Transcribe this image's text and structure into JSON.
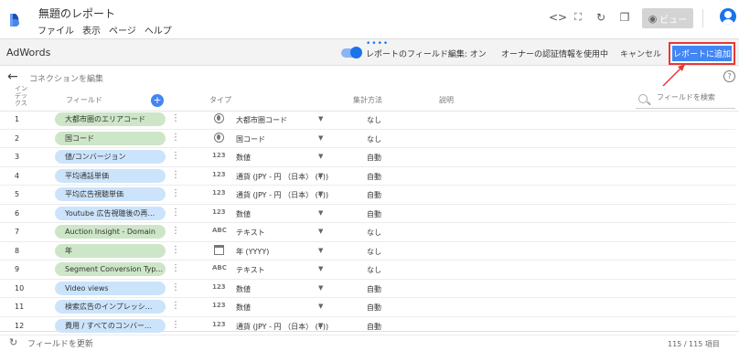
{
  "app": {
    "title": "無題のレポート",
    "menus": [
      "ファイル",
      "表示",
      "ページ",
      "ヘルプ"
    ],
    "view_label": "ビュー"
  },
  "toolbar": {
    "datasource": "AdWords",
    "field_edit_toggle": "レポートのフィールド編集: オン",
    "owner_credentials": "オーナーの認証情報を使用中",
    "cancel": "キャンセル",
    "add_to_report": "レポートに追加"
  },
  "nav": {
    "back_label": "コネクションを編集"
  },
  "table": {
    "headers": {
      "index": "イン\nデッ\nクス",
      "field": "フィールド",
      "type": "タイプ",
      "aggregation": "集計方法",
      "description": "説明"
    },
    "search_placeholder": "フィールドを検索",
    "rows": [
      {
        "index": "1",
        "field": "大都市圏のエリアコード",
        "kind": "dim",
        "type_icon": "globe",
        "type": "大都市圏コード",
        "aggregation": "なし"
      },
      {
        "index": "2",
        "field": "国コード",
        "kind": "dim",
        "type_icon": "globe",
        "type": "国コード",
        "aggregation": "なし"
      },
      {
        "index": "3",
        "field": "値/コンバージョン",
        "kind": "met",
        "type_icon": "123",
        "type": "数値",
        "aggregation": "自動"
      },
      {
        "index": "4",
        "field": "平均通話単価",
        "kind": "met",
        "type_icon": "123",
        "type": "通貨 (JPY - 円 （日本） (¥))",
        "aggregation": "自動"
      },
      {
        "index": "5",
        "field": "平均広告視聴単価",
        "kind": "met",
        "type_icon": "123",
        "type": "通貨 (JPY - 円 （日本） (¥))",
        "aggregation": "自動"
      },
      {
        "index": "6",
        "field": "Youtube 広告視聴後の再...",
        "kind": "met",
        "type_icon": "123",
        "type": "数値",
        "aggregation": "自動"
      },
      {
        "index": "7",
        "field": "Auction Insight - Domain",
        "kind": "dim",
        "type_icon": "ABC",
        "type": "テキスト",
        "aggregation": "なし"
      },
      {
        "index": "8",
        "field": "年",
        "kind": "dim",
        "type_icon": "calendar",
        "type": "年 (YYYY)",
        "aggregation": "なし"
      },
      {
        "index": "9",
        "field": "Segment Conversion Typ...",
        "kind": "dim",
        "type_icon": "ABC",
        "type": "テキスト",
        "aggregation": "なし"
      },
      {
        "index": "10",
        "field": "Video views",
        "kind": "met",
        "type_icon": "123",
        "type": "数値",
        "aggregation": "自動"
      },
      {
        "index": "11",
        "field": "検索広告のインプレッシ...",
        "kind": "met",
        "type_icon": "123",
        "type": "数値",
        "aggregation": "自動"
      },
      {
        "index": "12",
        "field": "費用 / すべてのコンバー...",
        "kind": "met",
        "type_icon": "123",
        "type": "通貨 (JPY - 円 （日本） (¥))",
        "aggregation": "自動"
      }
    ]
  },
  "footer": {
    "refresh_label": "フィールドを更新",
    "count": "115 / 115 項目"
  },
  "colors": {
    "accent": "#4285f4",
    "dimension_chip": "#cde6c7",
    "metric_chip": "#cce4fb",
    "highlight_border": "#e53935"
  }
}
